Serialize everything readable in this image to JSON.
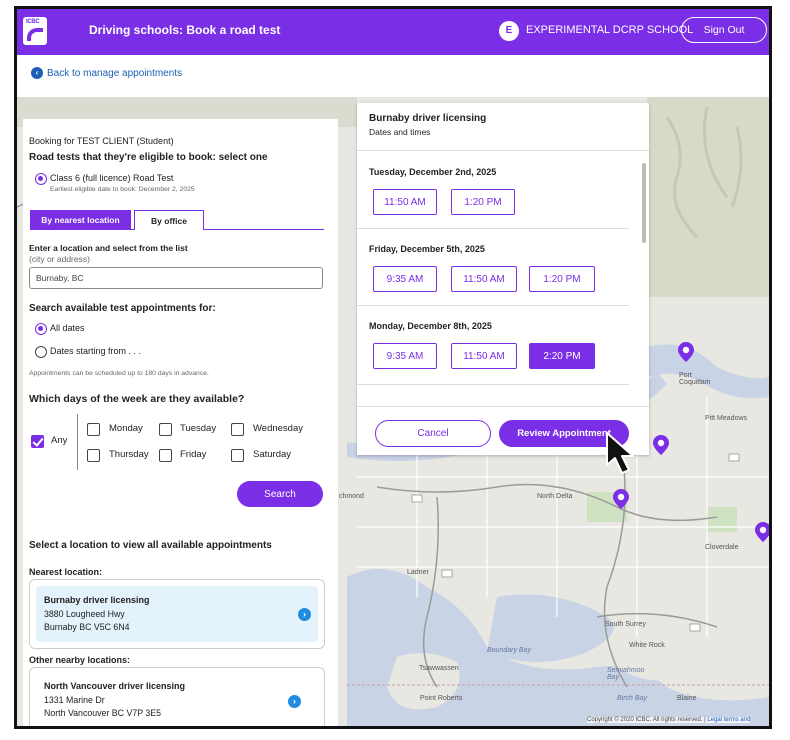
{
  "header": {
    "logo_text": "ICBC",
    "title": "Driving schools: Book a road test",
    "user_initial": "E",
    "school_name": "EXPERIMENTAL DCRP SCHOOL",
    "sign_out_label": "Sign Out",
    "brand_color": "#7a2ee6"
  },
  "nav": {
    "back_label": "Back to manage appointments"
  },
  "booking": {
    "booking_for": "Booking for TEST CLIENT (Student)",
    "eligible_heading": "Road tests that they're eligible to book: select one",
    "test_option": "Class 6 (full licence) Road Test",
    "earliest_date": "Earliest eligible date to book: December 2, 2025",
    "tabs": [
      "By nearest location",
      "By office"
    ],
    "location_label": "Enter a location and select from the list",
    "location_hint": "(city or address)",
    "location_value": "Burnaby, BC",
    "search_heading": "Search available test appointments for:",
    "option_all_dates": "All dates",
    "option_dates_from": "Dates starting from . . .",
    "advance_note": "Appointments can be scheduled up to 180 days in advance.",
    "days_heading": "Which days of the week are they available?",
    "any_label": "Any",
    "days": [
      "Monday",
      "Tuesday",
      "Wednesday",
      "Thursday",
      "Friday",
      "Saturday"
    ],
    "search_label": "Search",
    "select_location_heading": "Select a location to view all available appointments",
    "nearest_label": "Nearest location:",
    "nearest": {
      "name": "Burnaby driver licensing",
      "line1": "3880 Lougheed Hwy",
      "line2": "Burnaby BC V5C 6N4"
    },
    "other_label": "Other nearby locations:",
    "other": {
      "name": "North Vancouver driver licensing",
      "line1": "1331 Marine Dr",
      "line2": "North Vancouver BC V7P 3E5"
    }
  },
  "popup": {
    "title": "Burnaby driver licensing",
    "subtitle": "Dates and times",
    "days": [
      {
        "label": "Tuesday, December 2nd, 2025",
        "slots": [
          "11:50 AM",
          "1:20 PM"
        ]
      },
      {
        "label": "Friday, December 5th, 2025",
        "slots": [
          "9:35 AM",
          "11:50 AM",
          "1:20 PM"
        ]
      },
      {
        "label": "Monday, December 8th, 2025",
        "slots": [
          "9:35 AM",
          "11:50 AM",
          "2:20 PM"
        ],
        "selected": "2:20 PM"
      }
    ],
    "cancel_label": "Cancel",
    "review_label": "Review Appointment"
  },
  "map": {
    "labels": {
      "port_coquitlam": "Port\nCoquitlam",
      "pitt_meadows": "Pitt Meadows",
      "north_delta": "North Delta",
      "richmond": "chmond",
      "ladner": "Ladner",
      "south_surrey": "South Surrey",
      "white_rock": "White Rock",
      "boundary_bay": "Boundary Bay",
      "semiahmoo_bay": "Semiahmoo\nBay",
      "tsawwassen": "Tsawwassen",
      "point_roberts": "Point Roberts",
      "cloverdale": "Cloverdale",
      "blaine": "Blaine",
      "birch_bay": "Birch Bay"
    },
    "copyright": "Copyright © 2020 ICBC. All rights reserved.",
    "legal_terms": "Legal terms and",
    "water_color": "#c8d3e6",
    "land_color": "#e9e7e2"
  }
}
